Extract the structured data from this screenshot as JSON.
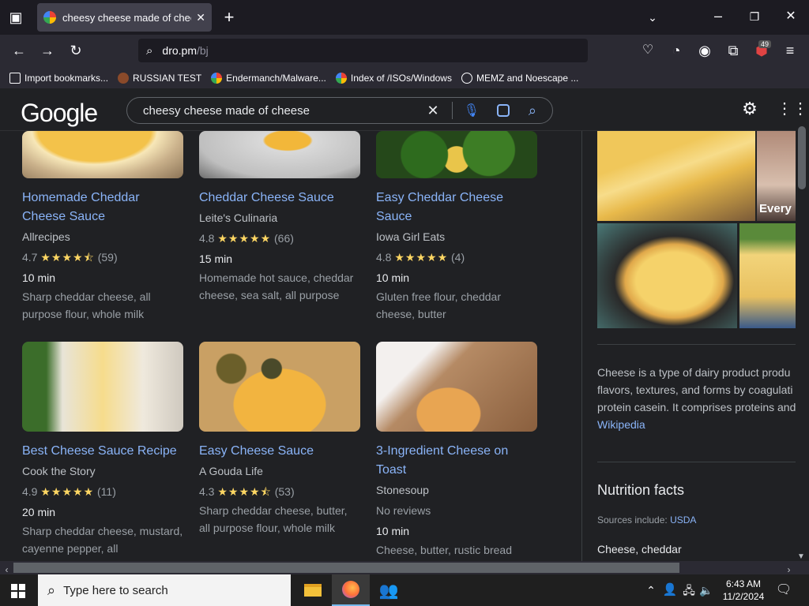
{
  "browser": {
    "tab_title": "cheesy cheese made of cheese",
    "url_host": "dro.pm",
    "url_path": "/bj",
    "notification_count": "49",
    "bookmarks": [
      {
        "label": "Import bookmarks...",
        "icon": "import-icon"
      },
      {
        "label": "RUSSIAN TEST",
        "icon": "site-icon"
      },
      {
        "label": "Endermanch/Malware...",
        "icon": "google-icon"
      },
      {
        "label": "Index of /ISOs/Windows",
        "icon": "google-icon"
      },
      {
        "label": "MEMZ and Noescape ...",
        "icon": "globe-icon"
      }
    ]
  },
  "google": {
    "logo": "Google",
    "query": "cheesy cheese made of cheese"
  },
  "recipes": [
    {
      "title": "Homemade Cheddar Cheese Sauce",
      "source": "Allrecipes",
      "rating": "4.7",
      "stars": "★★★★⯪",
      "reviews": "(59)",
      "time": "10 min",
      "ingredients": "Sharp cheddar cheese, all purpose flour, whole milk"
    },
    {
      "title": "Cheddar Cheese Sauce",
      "source": "Leite's Culinaria",
      "rating": "4.8",
      "stars": "★★★★★",
      "reviews": "(66)",
      "time": "15 min",
      "ingredients": "Homemade hot sauce, cheddar cheese, sea salt, all purpose"
    },
    {
      "title": "Easy Cheddar Cheese Sauce",
      "source": "Iowa Girl Eats",
      "rating": "4.8",
      "stars": "★★★★★",
      "reviews": "(4)",
      "time": "10 min",
      "ingredients": "Gluten free flour, cheddar cheese, butter"
    },
    {
      "title": "Best Cheese Sauce Recipe",
      "source": "Cook the Story",
      "rating": "4.9",
      "stars": "★★★★★",
      "reviews": "(11)",
      "time": "20 min",
      "ingredients": "Sharp cheddar cheese, mustard, cayenne pepper, all"
    },
    {
      "title": "Easy Cheese Sauce",
      "source": "A Gouda Life",
      "rating": "4.3",
      "stars": "★★★★⯪",
      "reviews": "(53)",
      "time": "",
      "ingredients": "Sharp cheddar cheese, butter, all purpose flour, whole milk"
    },
    {
      "title": "3-Ingredient Cheese on Toast",
      "source": "Stonesoup",
      "rating": "No reviews",
      "stars": "",
      "reviews": "",
      "time": "10 min",
      "ingredients": "Cheese, butter, rustic bread"
    }
  ],
  "knowledge": {
    "image_caption": "Every",
    "desc1": "Cheese is a type of dairy product produ",
    "desc2": "flavors, textures, and forms by coagulati",
    "desc3": "protein casein. It comprises proteins and",
    "wiki": "Wikipedia",
    "nutrition_title": "Nutrition facts",
    "sources_label": "Sources include:",
    "sources_link": "USDA",
    "item": "Cheese, cheddar"
  },
  "taskbar": {
    "search_placeholder": "Type here to search",
    "time": "6:43 AM",
    "date": "11/2/2024"
  },
  "colors": {
    "link": "#8ab4f8",
    "star": "#fdd663",
    "background": "#202124"
  }
}
